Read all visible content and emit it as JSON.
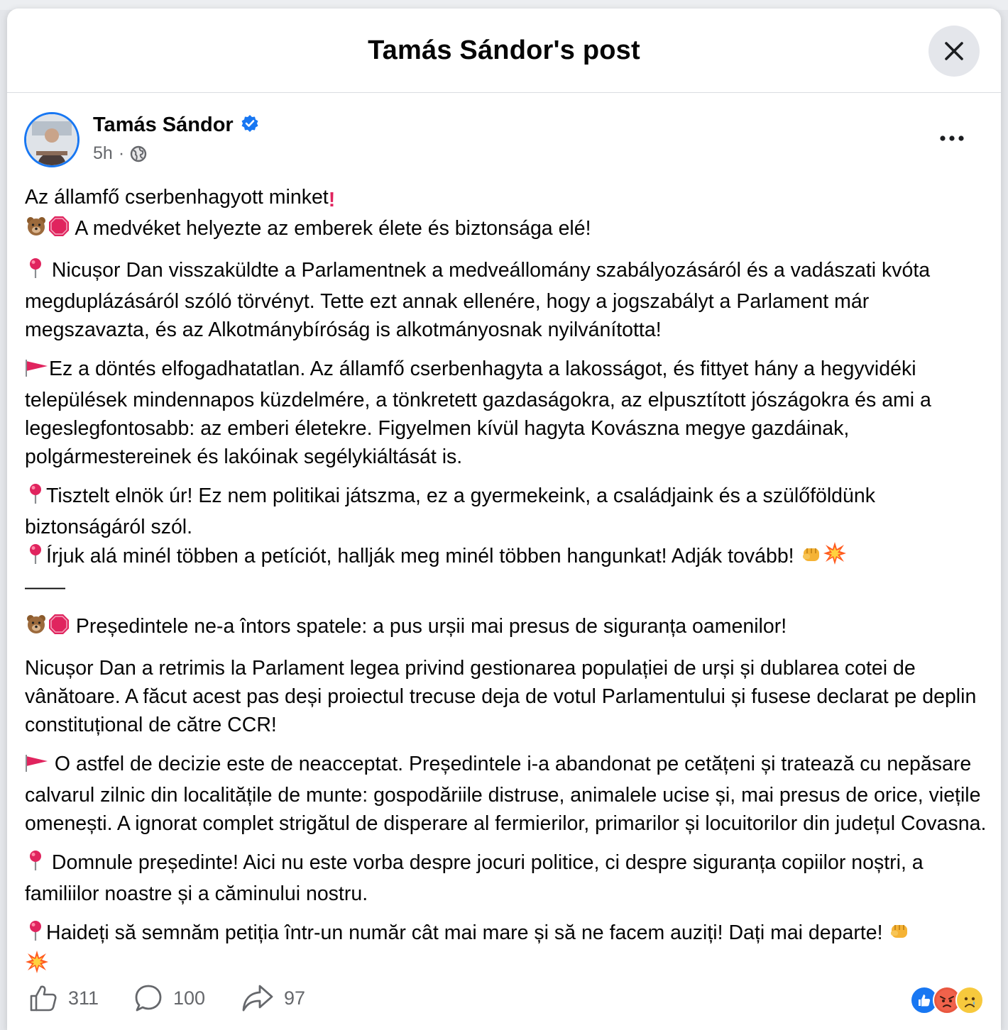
{
  "modal": {
    "title": "Tamás Sándor's post"
  },
  "post": {
    "author": "Tamás Sándor",
    "time": "5h",
    "separator": "·",
    "lines": {
      "hu_title": "Az államfő cserbenhagyott minket",
      "hu_sub": " A medvéket helyezte az emberek élete és biztonsága elé!",
      "hu_p1": " Nicușor Dan visszaküldte a Parlamentnek a medveállomány szabályozásáról és a vadászati kvóta megduplázásáról szóló törvényt. Tette ezt annak ellenére, hogy a jogszabályt a Parlament már megszavazta, és az Alkotmánybíróság is alkotmányosnak nyilvánította!",
      "hu_p2": "Ez a döntés elfogadhatatlan. Az államfő cserbenhagyta a lakosságot, és fittyet hány a hegyvidéki települések mindennapos küzdelmére, a tönkretett gazdaságokra, az elpusztított jószágokra és ami a legeslegfontosabb: az emberi életekre. Figyelmen kívül hagyta Kovászna megye gazdáinak, polgármestereinek és lakóinak segélykiáltását is.",
      "hu_p3a": "Tisztelt elnök úr! Ez nem politikai játszma, ez a gyermekeink, a családjaink és a szülőföldünk biztonságáról szól.",
      "hu_p3b": "Írjuk alá minél többen a petíciót, hallják meg minél többen hangunkat! Adják tovább! ",
      "divider": "——",
      "ro_title": " Președintele ne-a întors spatele: a pus urșii mai presus de siguranța oamenilor!",
      "ro_p1": "Nicușor Dan a retrimis la Parlament legea privind gestionarea populației de urși și dublarea cotei de vânătoare. A făcut acest pas deși proiectul trecuse deja de votul Parlamentului și fusese declarat pe deplin constituțional de către CCR!",
      "ro_p2": " O astfel de decizie este de neacceptat. Președintele i-a abandonat pe cetățeni și tratează cu nepăsare calvarul zilnic din localitățile de munte: gospodăriile distruse, animalele ucise și, mai presus de orice, viețile omenești. A ignorat complet strigătul de disperare al fermierilor, primarilor și locuitorilor din județul Covasna.",
      "ro_p3": " Domnule președinte! Aici nu este vorba despre jocuri politice, ci despre siguranța copiilor noștri, a familiilor noastre și a căminului nostru.",
      "ro_p4": "Haideți să semnăm petiția într-un număr cât mai mare și să ne facem auziți! Dați mai departe! "
    },
    "stats": {
      "likes": "311",
      "comments": "100",
      "shares": "97"
    }
  },
  "icons": [
    "close-icon",
    "verified-badge-icon",
    "globe-icon",
    "more-options-icon",
    "bear-emoji",
    "stop-sign-emoji",
    "red-pin-emoji",
    "red-flag-emoji",
    "fist-emoji",
    "collision-emoji",
    "like-icon",
    "comment-icon",
    "share-icon",
    "like-reaction-icon",
    "angry-reaction-icon",
    "sad-reaction-icon"
  ],
  "colors": {
    "accent": "#1877f2",
    "secondary_text": "#65676b",
    "pin_red": "#e0245e"
  }
}
